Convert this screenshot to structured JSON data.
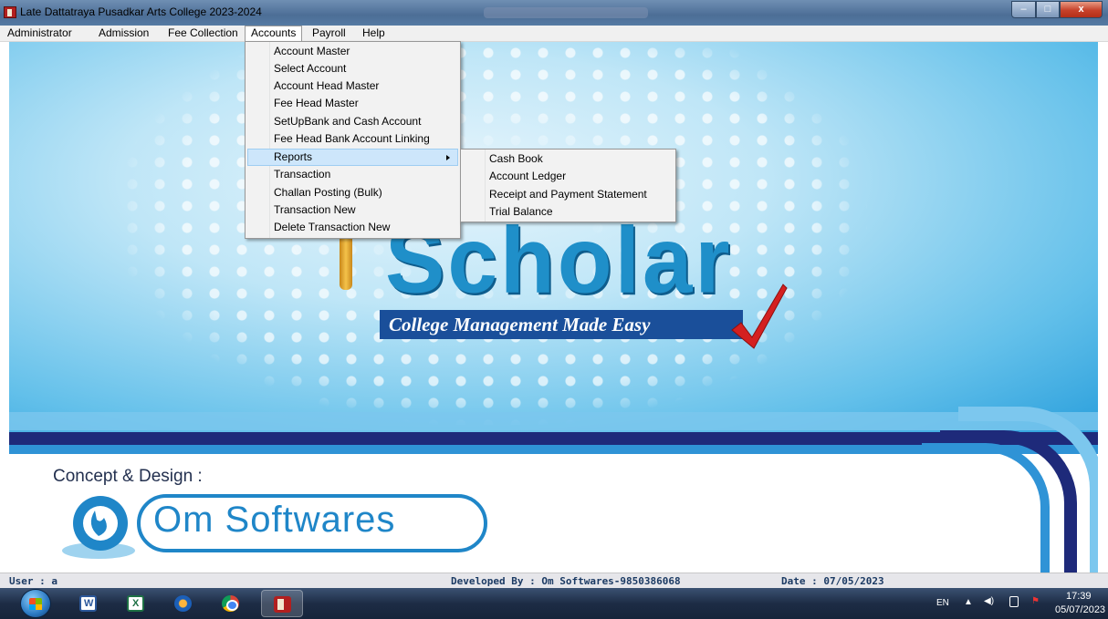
{
  "window": {
    "title": "Late Dattatraya Pusadkar Arts College 2023-2024",
    "buttons": {
      "minimize": "–",
      "maximize": "□",
      "close": "x"
    }
  },
  "menubar": {
    "items": [
      "Administrator",
      "Admission",
      "Fee Collection",
      "Accounts",
      "Payroll",
      "Help"
    ],
    "active": "Accounts"
  },
  "accounts_menu": {
    "items": [
      "Account Master",
      "Select Account",
      "Account Head Master",
      "Fee Head Master",
      "SetUpBank and Cash Account",
      "Fee Head Bank Account Linking",
      "Reports",
      "Transaction",
      "Challan Posting (Bulk)",
      "Transaction New",
      "Delete Transaction  New"
    ],
    "highlighted": "Reports"
  },
  "reports_submenu": {
    "items": [
      "Cash Book",
      "Account Ledger",
      "Receipt and Payment Statement",
      "Trial Balance"
    ]
  },
  "splash": {
    "logo_word": "Scholar",
    "tagline": "College Management Made Easy",
    "concept_label": "Concept & Design :",
    "vendor_logo": "Om Softwares"
  },
  "statusbar": {
    "user": "User : a",
    "developer": "Developed By : Om Softwares-9850386068",
    "date": "Date : 07/05/2023"
  },
  "taskbar": {
    "apps": [
      "start-orb",
      "word-icon",
      "excel-icon",
      "media-player-icon",
      "chrome-icon",
      "scholar-app-icon"
    ],
    "language": "EN",
    "time": "17:39",
    "date": "05/07/2023"
  },
  "colors": {
    "titlebar": "#557aa3",
    "menu_highlight": "#cde6fb",
    "brand_blue": "#1f8fc9",
    "tagline_bg": "#1a4f9a",
    "status_text": "#1b3a63"
  }
}
